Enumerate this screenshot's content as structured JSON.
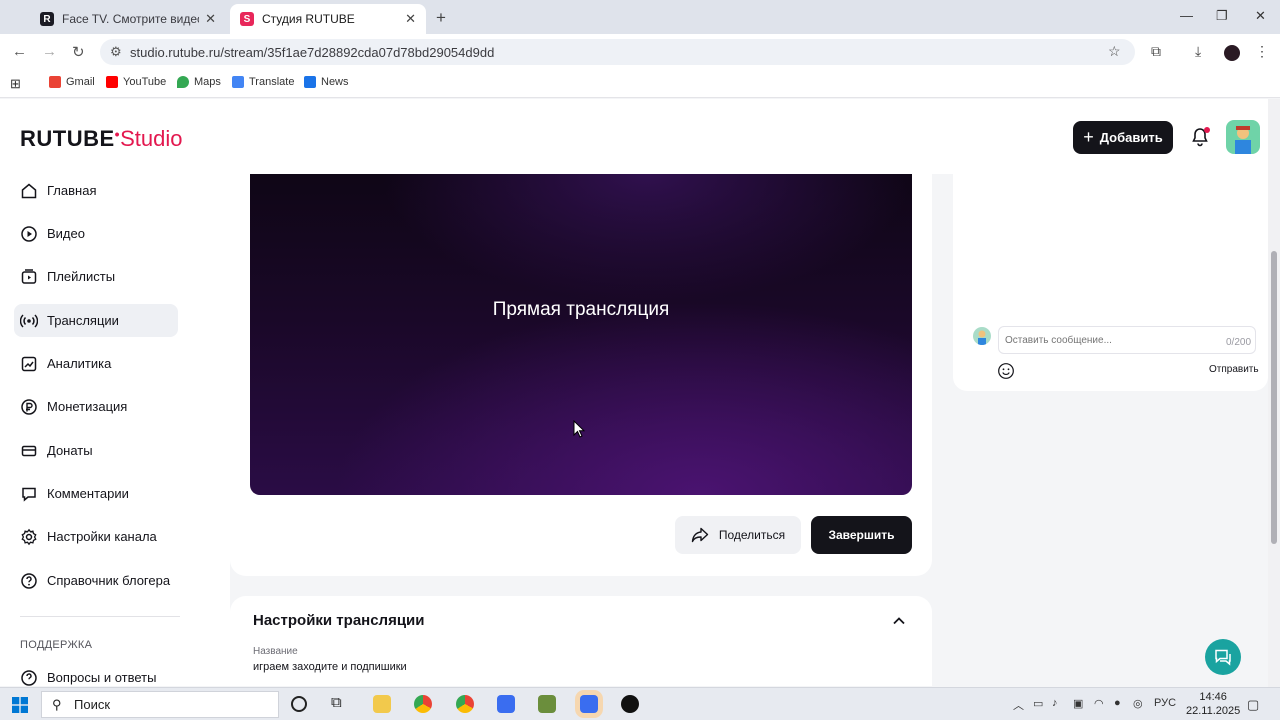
{
  "browser": {
    "tabs": [
      {
        "title": "Face TV. Смотрите видео онлайн",
        "favicon": "R"
      },
      {
        "title": "Студия RUTUBE",
        "favicon": "S"
      }
    ],
    "url": "studio.rutube.ru/stream/35f1ae7d28892cda07d78bd29054d9dd",
    "bookmarks": [
      {
        "label": "Gmail",
        "color": "#ea4335"
      },
      {
        "label": "YouTube",
        "color": "#ff0000"
      },
      {
        "label": "Maps",
        "color": "#34a853"
      },
      {
        "label": "Translate",
        "color": "#4285f4"
      },
      {
        "label": "News",
        "color": "#1a73e8"
      }
    ]
  },
  "header": {
    "logo_main": "RUTUBE",
    "logo_sub": "Studio",
    "add_label": "Добавить",
    "accent": "#e3184f"
  },
  "sidebar": {
    "items": [
      {
        "label": "Главная",
        "icon": "home-icon"
      },
      {
        "label": "Видео",
        "icon": "video-icon"
      },
      {
        "label": "Плейлисты",
        "icon": "playlist-icon"
      },
      {
        "label": "Трансляции",
        "icon": "broadcast-icon",
        "active": true
      },
      {
        "label": "Аналитика",
        "icon": "analytics-icon"
      },
      {
        "label": "Монетизация",
        "icon": "monetization-icon"
      },
      {
        "label": "Донаты",
        "icon": "donate-icon"
      },
      {
        "label": "Комментарии",
        "icon": "comments-icon"
      },
      {
        "label": "Настройки канала",
        "icon": "gear-icon"
      },
      {
        "label": "Справочник блогера",
        "icon": "help-circle-icon"
      }
    ],
    "section_label": "ПОДДЕРЖКА",
    "support_items": [
      {
        "label": "Вопросы и ответы",
        "icon": "faq-icon"
      }
    ]
  },
  "player": {
    "title": "Прямая трансляция"
  },
  "actions": {
    "share_label": "Поделиться",
    "finish_label": "Завершить"
  },
  "settings": {
    "title": "Настройки трансляции",
    "name_label": "Название",
    "name_value": "играем заходите и подпишики"
  },
  "chat": {
    "placeholder": "Оставить сообщение...",
    "counter": "0/200",
    "send_label": "Отправить"
  },
  "taskbar": {
    "search_label": "Поиск",
    "language": "РУС",
    "time": "14:46",
    "date": "22.11.2025"
  }
}
